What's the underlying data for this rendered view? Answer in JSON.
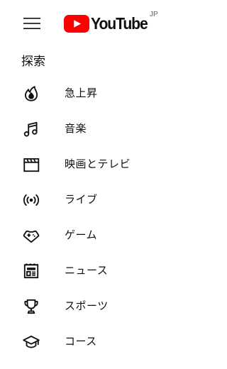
{
  "header": {
    "logo_text": "YouTube",
    "country_code": "JP",
    "brand_color": "#ff0000"
  },
  "explore": {
    "title": "探索",
    "items": [
      {
        "label": "急上昇",
        "icon": "trending-flame-icon"
      },
      {
        "label": "音楽",
        "icon": "music-note-icon"
      },
      {
        "label": "映画とテレビ",
        "icon": "clapperboard-icon"
      },
      {
        "label": "ライブ",
        "icon": "live-broadcast-icon"
      },
      {
        "label": "ゲーム",
        "icon": "gamepad-icon"
      },
      {
        "label": "ニュース",
        "icon": "newspaper-icon"
      },
      {
        "label": "スポーツ",
        "icon": "trophy-icon"
      },
      {
        "label": "コース",
        "icon": "graduation-cap-icon"
      }
    ]
  }
}
